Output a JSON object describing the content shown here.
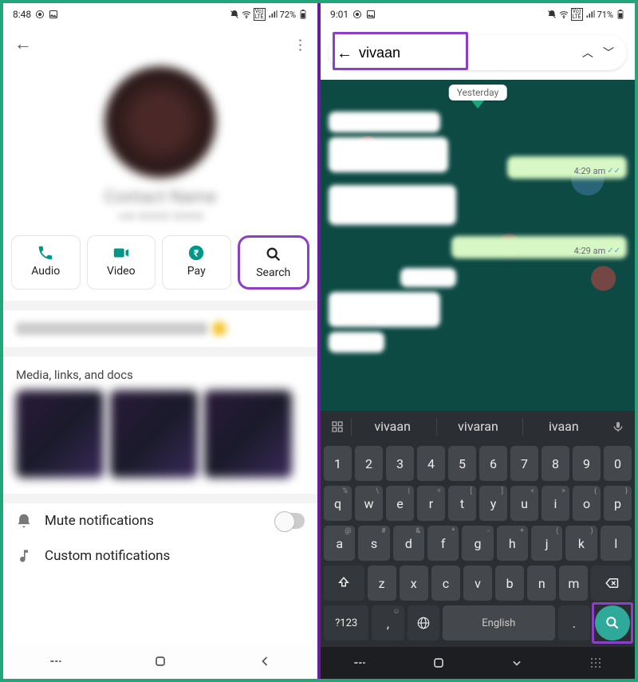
{
  "left": {
    "status": {
      "time": "8:48",
      "battery": "72%"
    },
    "name": "Contact Name",
    "phone": "+00 00000 00000",
    "actions": {
      "audio": "Audio",
      "video": "Video",
      "pay": "Pay",
      "search": "Search"
    },
    "media_title": "Media, links, and docs",
    "mute": "Mute notifications",
    "custom": "Custom notifications"
  },
  "right": {
    "status": {
      "time": "9:01",
      "battery": "71%"
    },
    "search_value": "vivaan",
    "date_chip": "Yesterday",
    "times": {
      "t1": "4:29 am",
      "t2": "4:29 am"
    },
    "suggestions": [
      "vivaan",
      "vivaran",
      "ivaan"
    ],
    "rows": {
      "nums": [
        "1",
        "2",
        "3",
        "4",
        "5",
        "6",
        "7",
        "8",
        "9",
        "0"
      ],
      "r1": [
        "q",
        "w",
        "e",
        "r",
        "t",
        "y",
        "u",
        "i",
        "o",
        "p"
      ],
      "r1s": [
        "%",
        "\\",
        "|",
        "=",
        "[",
        "]",
        "<",
        ">",
        "{",
        "}"
      ],
      "r2": [
        "a",
        "s",
        "d",
        "f",
        "g",
        "h",
        "j",
        "k",
        "l"
      ],
      "r2s": [
        "@",
        "#",
        "&",
        "*",
        "-",
        "+",
        "(",
        ")",
        ""
      ],
      "r3": [
        "z",
        "x",
        "c",
        "v",
        "b",
        "n",
        "m"
      ],
      "sym": "?123",
      "space": "English"
    }
  }
}
